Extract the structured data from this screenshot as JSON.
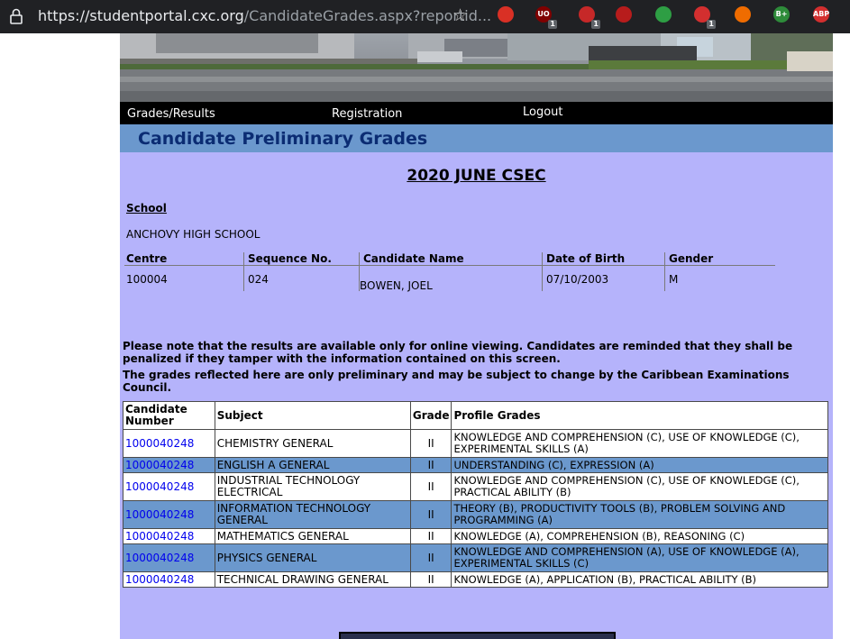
{
  "browser": {
    "url_host": "https://studentportal.cxc.org",
    "url_path": "/CandidateGrades.aspx?reportid...",
    "extensions": [
      {
        "name": "ext-record-icon",
        "color": "#d93025",
        "label": "",
        "badge": ""
      },
      {
        "name": "ext-ublock-icon",
        "color": "#800000",
        "label": "UO",
        "badge": "1"
      },
      {
        "name": "ext-shield-red-icon",
        "color": "#c62828",
        "label": "",
        "badge": "1"
      },
      {
        "name": "ext-privacy-badger-icon",
        "color": "#b71c1c",
        "label": "",
        "badge": ""
      },
      {
        "name": "ext-shield-green-icon",
        "color": "#2e9e44",
        "label": "",
        "badge": ""
      },
      {
        "name": "ext-lock-red-icon",
        "color": "#d32f2f",
        "label": "",
        "badge": "1"
      },
      {
        "name": "ext-orange-icon",
        "color": "#ef6c00",
        "label": "",
        "badge": ""
      },
      {
        "name": "ext-bplus-icon",
        "color": "#2e8b3a",
        "label": "B+",
        "badge": ""
      },
      {
        "name": "ext-abp-icon",
        "color": "#d32f2f",
        "label": "ABP",
        "badge": ""
      }
    ]
  },
  "nav": {
    "grades": "Grades/Results",
    "registration": "Registration",
    "logout": "Logout"
  },
  "page_title": "Candidate Preliminary Grades",
  "exam_title": "2020 JUNE CSEC",
  "school": {
    "label": "School",
    "name": "ANCHOVY HIGH SCHOOL"
  },
  "candidate_info": {
    "headers": {
      "centre": "Centre",
      "sequence": "Sequence No.",
      "name": "Candidate Name",
      "dob": "Date of Birth",
      "gender": "Gender"
    },
    "values": {
      "centre": "100004",
      "sequence": "024",
      "name": "BOWEN, JOEL",
      "dob": "07/10/2003",
      "gender": "M"
    }
  },
  "notice": {
    "line1": "Please note that the results are available only for online viewing. Candidates are reminded that they shall be penalized if they tamper with the information contained on this screen.",
    "line2": "The grades reflected here are only preliminary and may be subject to change by the Caribbean Examinations Council."
  },
  "grades_table": {
    "headers": {
      "candidate_number": "Candidate Number",
      "subject": "Subject",
      "grade": "Grade",
      "profile": "Profile Grades"
    },
    "rows": [
      {
        "candidate_number": "1000040248",
        "subject": "CHEMISTRY GENERAL",
        "grade": "II",
        "profile": "KNOWLEDGE AND COMPREHENSION (C), USE OF KNOWLEDGE (C), EXPERIMENTAL SKILLS (A)"
      },
      {
        "candidate_number": "1000040248",
        "subject": "ENGLISH A GENERAL",
        "grade": "II",
        "profile": "UNDERSTANDING (C), EXPRESSION (A)"
      },
      {
        "candidate_number": "1000040248",
        "subject": "INDUSTRIAL TECHNOLOGY ELECTRICAL",
        "grade": "II",
        "profile": "KNOWLEDGE AND COMPREHENSION (C), USE OF KNOWLEDGE (C), PRACTICAL ABILITY (B)"
      },
      {
        "candidate_number": "1000040248",
        "subject": "INFORMATION TECHNOLOGY GENERAL",
        "grade": "II",
        "profile": "THEORY (B), PRODUCTIVITY TOOLS (B), PROBLEM SOLVING AND PROGRAMMING (A)"
      },
      {
        "candidate_number": "1000040248",
        "subject": "MATHEMATICS GENERAL",
        "grade": "II",
        "profile": "KNOWLEDGE (A), COMPREHENSION (B), REASONING (C)"
      },
      {
        "candidate_number": "1000040248",
        "subject": "PHYSICS GENERAL",
        "grade": "II",
        "profile": "KNOWLEDGE AND COMPREHENSION (A), USE OF KNOWLEDGE (A), EXPERIMENTAL SKILLS (C)"
      },
      {
        "candidate_number": "1000040248",
        "subject": "TECHNICAL DRAWING GENERAL",
        "grade": "II",
        "profile": "KNOWLEDGE (A), APPLICATION (B), PRACTICAL ABILITY (B)"
      }
    ]
  }
}
